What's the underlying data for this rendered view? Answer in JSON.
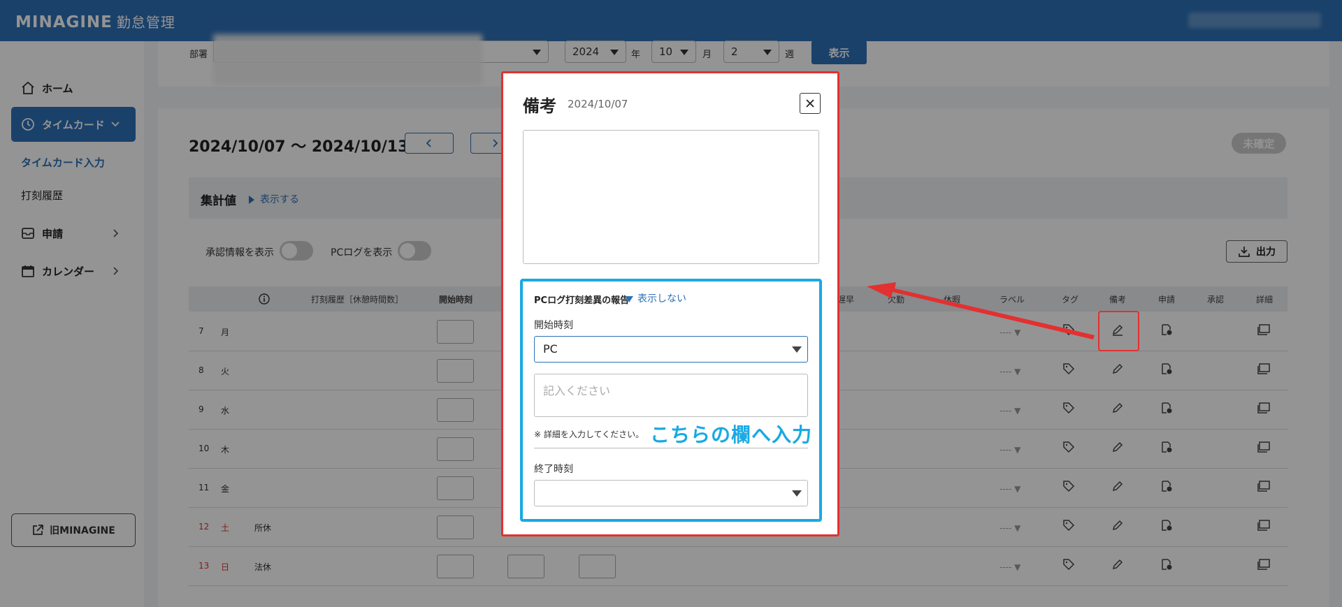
{
  "header": {
    "logo": "MINAGINE",
    "logo_sub": "勤怠管理"
  },
  "sidebar": {
    "home": "ホーム",
    "timecard": "タイムカード",
    "timecard_input": "タイムカード入力",
    "punch_history": "打刻履歴",
    "request": "申請",
    "calendar": "カレンダー",
    "old_link": "旧MINAGINE"
  },
  "filter": {
    "dept_label": "部署",
    "year": "2024",
    "year_unit": "年",
    "month": "10",
    "month_unit": "月",
    "week": "2",
    "week_unit": "週",
    "show_button": "表示"
  },
  "main": {
    "date_range": "2024/10/07 〜 2024/10/13",
    "status_badge": "未確定",
    "summary_title": "集計値",
    "summary_toggle": "表示する",
    "toggle_approval": "承認情報を表示",
    "toggle_pclog": "PCログを表示",
    "export": "出力"
  },
  "table": {
    "headers": {
      "history": "打刻履歴［休憩時間数］",
      "start": "開始時刻",
      "early": "遅早",
      "absent": "欠勤",
      "leave": "休暇",
      "label": "ラベル",
      "tag": "タグ",
      "remarks": "備考",
      "request": "申請",
      "approval": "承認",
      "detail": "詳細"
    },
    "rows": [
      {
        "day": "7",
        "wd": "月",
        "holiday": ""
      },
      {
        "day": "8",
        "wd": "火",
        "holiday": ""
      },
      {
        "day": "9",
        "wd": "水",
        "holiday": ""
      },
      {
        "day": "10",
        "wd": "木",
        "holiday": ""
      },
      {
        "day": "11",
        "wd": "金",
        "holiday": ""
      },
      {
        "day": "12",
        "wd": "土",
        "holiday": "所休"
      },
      {
        "day": "13",
        "wd": "日",
        "holiday": "法休"
      }
    ],
    "label_placeholder": "----"
  },
  "modal": {
    "title": "備考",
    "date": "2024/10/07",
    "pc_section_title": "PCログ打刻差異の報告",
    "pc_section_toggle": "表示しない",
    "start_label": "開始時刻",
    "start_value": "PC",
    "detail_placeholder": "記入ください",
    "note": "※ 詳細を入力してください。",
    "annotation": "こちらの欄へ入力",
    "end_label": "終了時刻",
    "end_value": ""
  },
  "colors": {
    "brand": "#2d70b7",
    "highlight_red": "#e33030",
    "highlight_cyan": "#19a9e3"
  }
}
